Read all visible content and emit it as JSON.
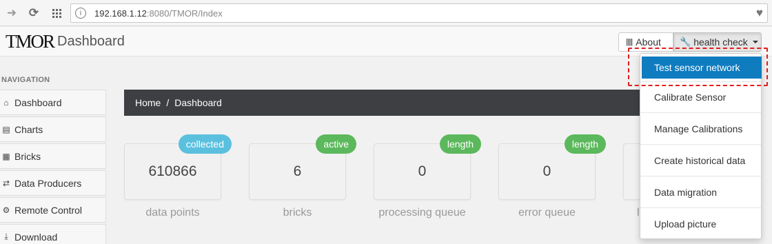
{
  "browser": {
    "url_host": "192.168.1.12",
    "url_rest": ":8080/TMOR/Index",
    "back_icon": "arrow-right-icon",
    "reload_icon": "reload-icon",
    "apps_icon": "apps-grid-icon",
    "site_icon": "site-info-icon",
    "bookmark_icon": "heart-icon"
  },
  "navbar": {
    "logo": "TMOR",
    "title": "Dashboard",
    "about_label": "About",
    "health_label": "health check"
  },
  "sidebar": {
    "heading": "NAVIGATION",
    "items": [
      {
        "label": "Dashboard",
        "icon": "home-icon"
      },
      {
        "label": "Charts",
        "icon": "list-icon"
      },
      {
        "label": "Bricks",
        "icon": "grid-icon"
      },
      {
        "label": "Data Producers",
        "icon": "shuffle-icon"
      },
      {
        "label": "Remote Control",
        "icon": "cog-icon"
      },
      {
        "label": "Download",
        "icon": "download-icon"
      }
    ]
  },
  "breadcrumb": {
    "home": "Home",
    "separator": "/",
    "current": "Dashboard"
  },
  "stats": [
    {
      "value": "610866",
      "badge": "collected",
      "badge_color": "#5bc0de",
      "label": "data points"
    },
    {
      "value": "6",
      "badge": "active",
      "badge_color": "#5cb85c",
      "label": "bricks"
    },
    {
      "value": "0",
      "badge": "length",
      "badge_color": "#5cb85c",
      "label": "processing queue"
    },
    {
      "value": "0",
      "badge": "length",
      "badge_color": "#5cb85c",
      "label": "error queue"
    },
    {
      "value": "",
      "badge": "",
      "label": "l"
    }
  ],
  "dropdown": {
    "items": [
      {
        "label": "Test sensor network",
        "active": true
      },
      {
        "label": "Calibrate Sensor"
      },
      {
        "label": "Manage Calibrations"
      },
      {
        "label": "Create historical data"
      },
      {
        "label": "Data migration"
      },
      {
        "label": "Upload picture"
      }
    ]
  },
  "colors": {
    "accent": "#0f7cc0",
    "highlight": "#e21b1b",
    "breadcrumb_bg": "#3d3f42"
  }
}
